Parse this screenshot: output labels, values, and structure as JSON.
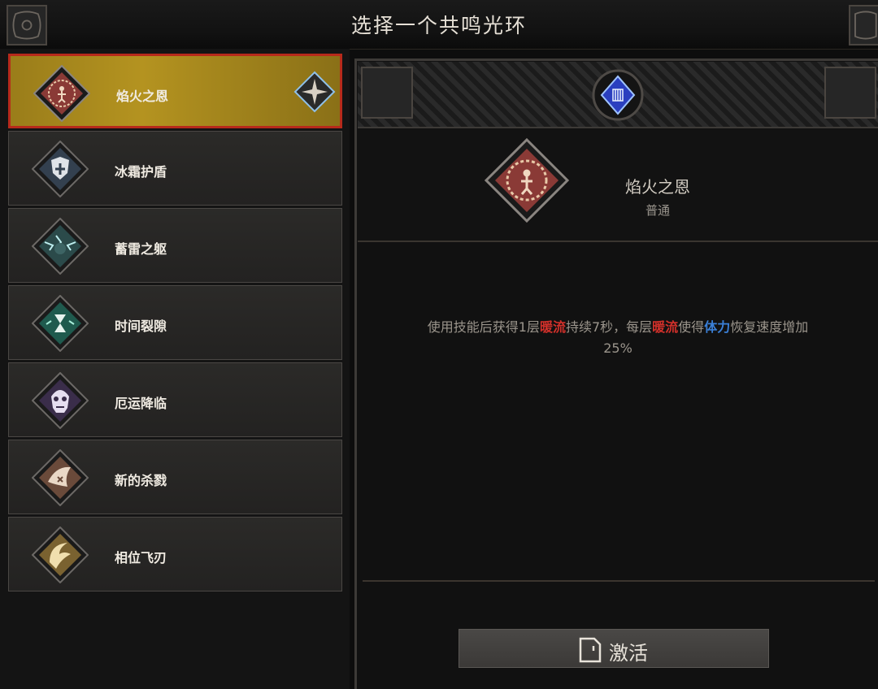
{
  "title": "选择一个共鸣光环",
  "auras": [
    {
      "label": "焰火之恩",
      "icon": "flame-grace-icon",
      "color": "#8a3a36",
      "selected": true
    },
    {
      "label": "冰霜护盾",
      "icon": "frost-shield-icon",
      "color": "#33404f",
      "selected": false
    },
    {
      "label": "蓄雷之躯",
      "icon": "thunder-body-icon",
      "color": "#2b4a4a",
      "selected": false
    },
    {
      "label": "时间裂隙",
      "icon": "time-rift-icon",
      "color": "#1f5a4e",
      "selected": false
    },
    {
      "label": "厄运降临",
      "icon": "doom-skull-icon",
      "color": "#3a2d4a",
      "selected": false
    },
    {
      "label": "新的杀戮",
      "icon": "new-slaughter-icon",
      "color": "#6a4a3a",
      "selected": false
    },
    {
      "label": "相位飞刃",
      "icon": "phase-blade-icon",
      "color": "#7a6230",
      "selected": false
    }
  ],
  "detail": {
    "name": "焰火之恩",
    "rarity": "普通",
    "description": {
      "p1": "使用技能后获得1层",
      "k1": "暖流",
      "p2": "持续7秒，每层",
      "k2": "暖流",
      "p3": "使得",
      "k3": "体力",
      "p4": "恢复速度增加",
      "p5": "25%"
    }
  },
  "activate_label": "激活",
  "colors": {
    "selected_bg": "#b49320",
    "selected_border": "#b72a1b",
    "keyword_red": "#d0302a",
    "keyword_blue": "#3a7fd6"
  }
}
